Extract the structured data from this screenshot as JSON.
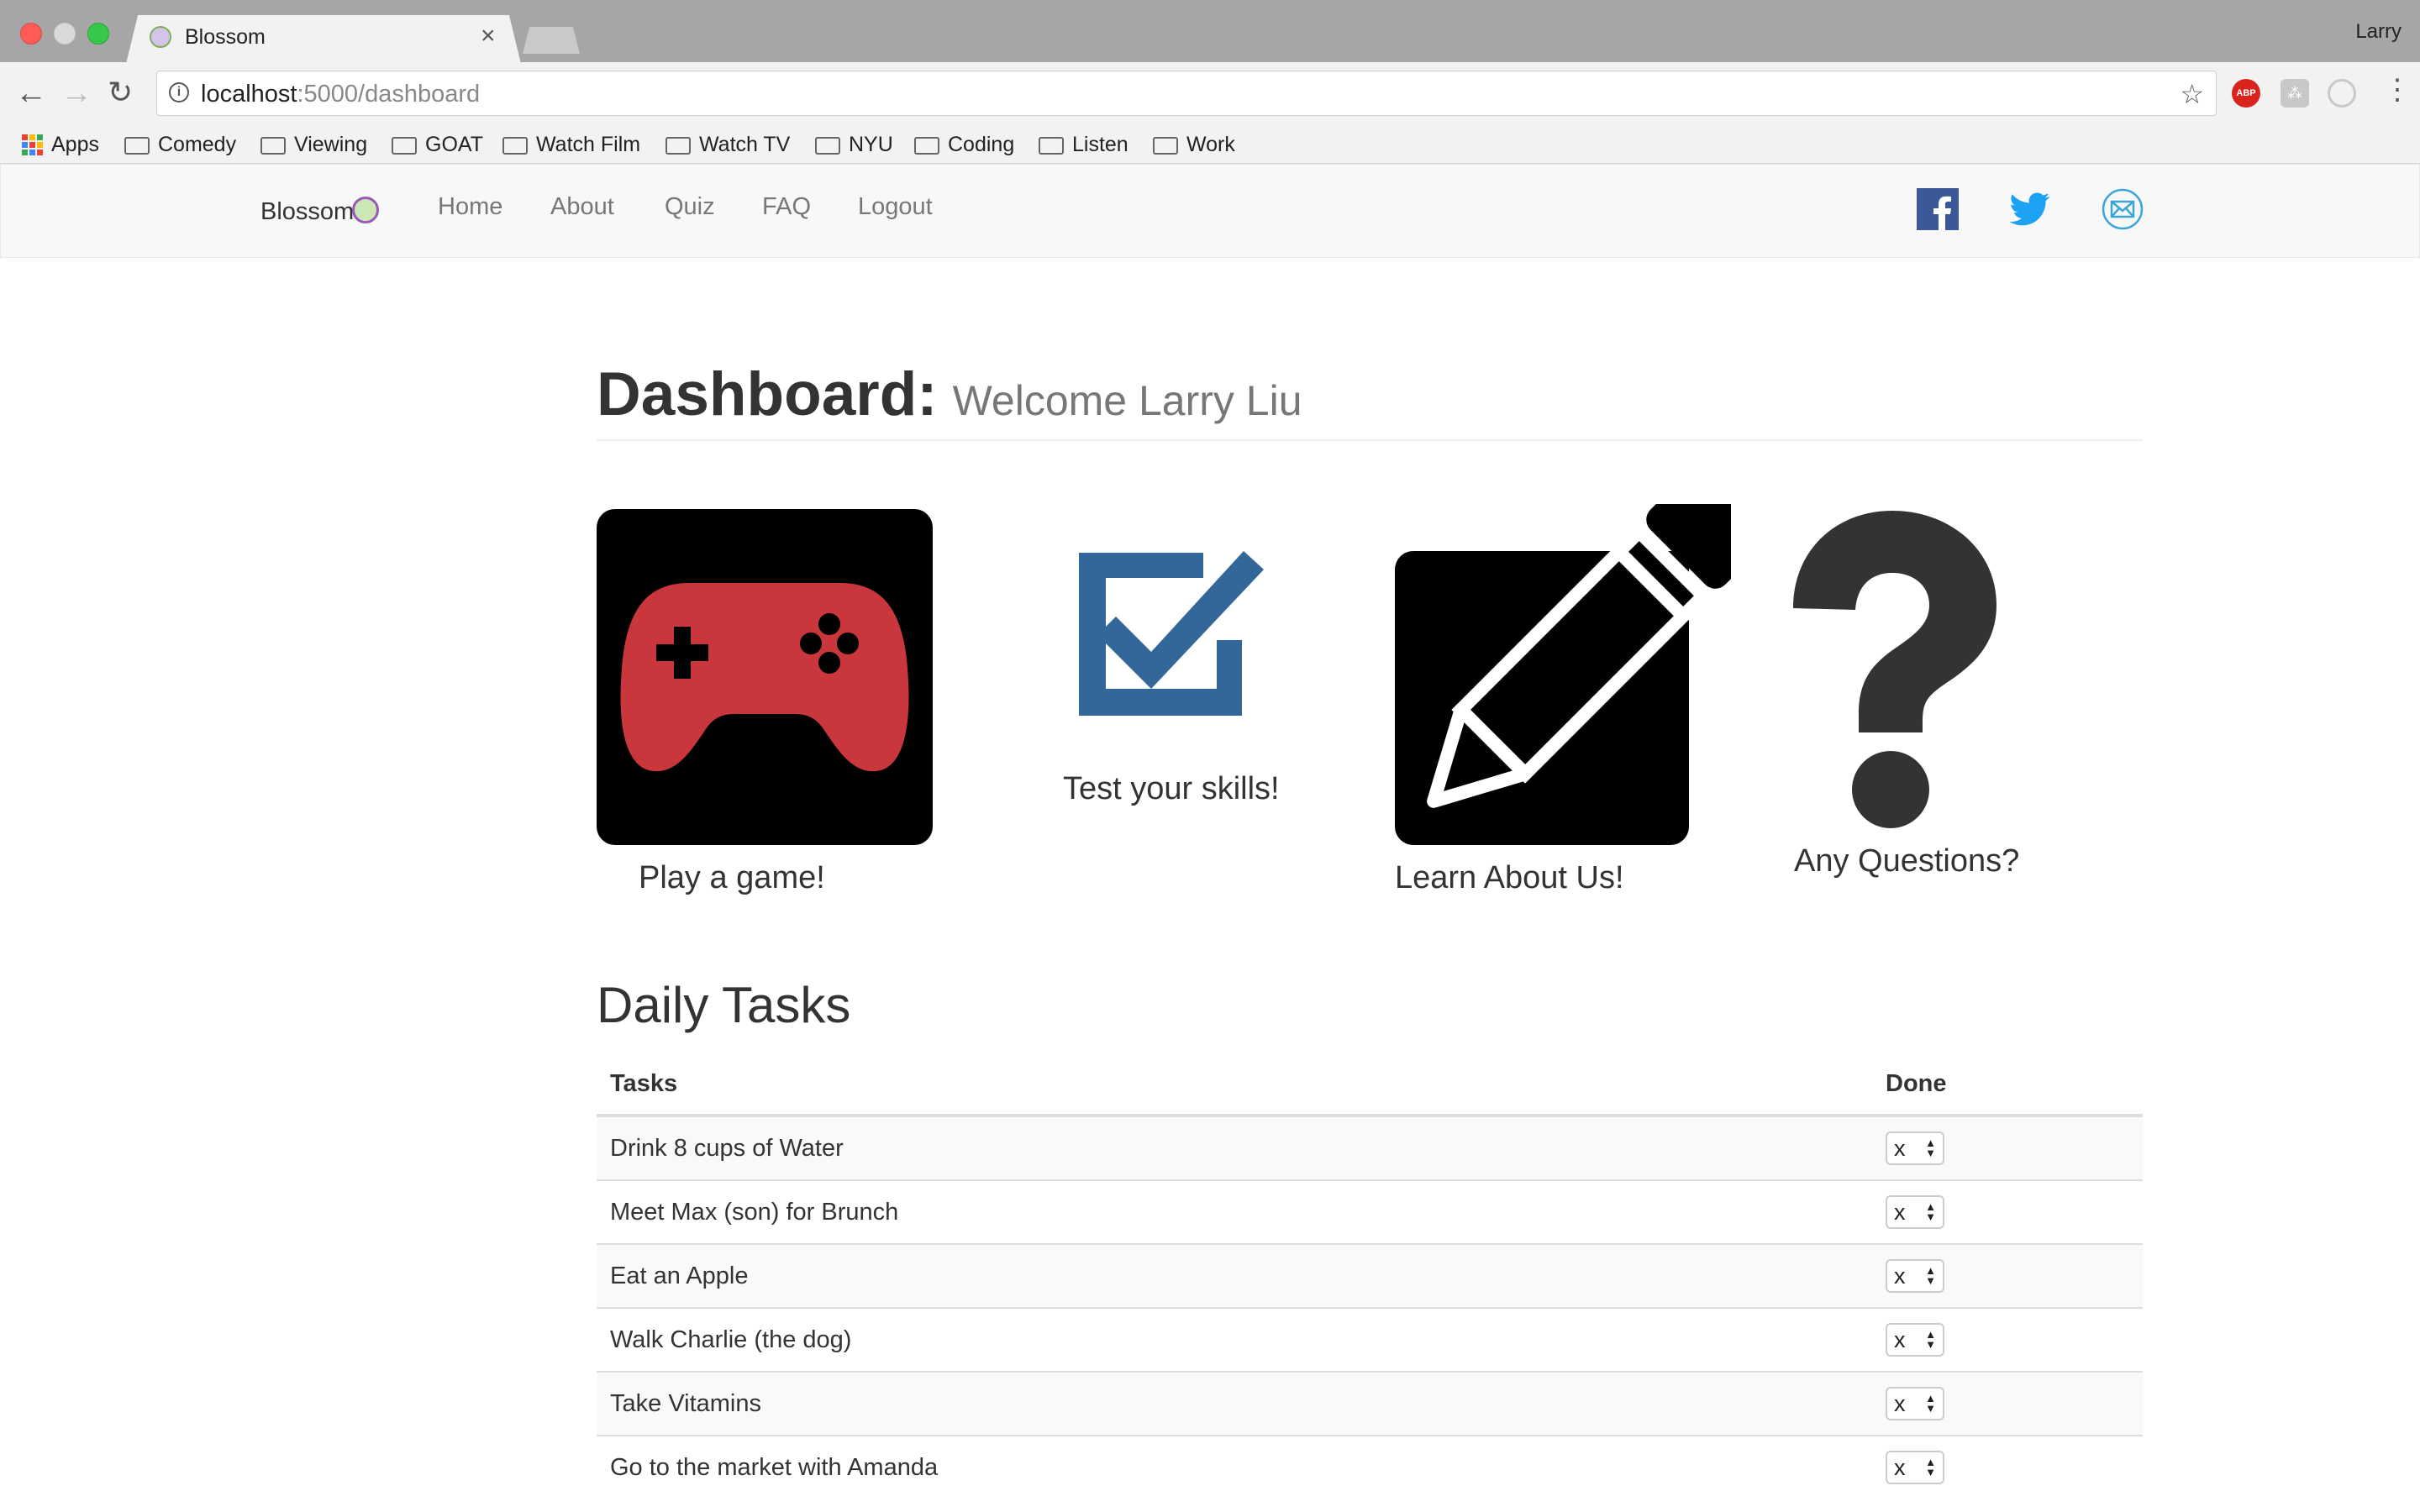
{
  "browser": {
    "tab_title": "Blossom",
    "tab_close": "×",
    "profile_name": "Larry",
    "url_host": "localhost",
    "url_path": ":5000/dashboard",
    "bookmarks": [
      "Apps",
      "Comedy",
      "Viewing",
      "GOAT",
      "Watch Film",
      "Watch TV",
      "NYU",
      "Coding",
      "Listen",
      "Work"
    ]
  },
  "navbar": {
    "brand": "Blossom",
    "links": [
      "Home",
      "About",
      "Quiz",
      "FAQ",
      "Logout"
    ],
    "social": [
      "facebook-icon",
      "twitter-icon",
      "mail-icon"
    ]
  },
  "dashboard": {
    "title": "Dashboard:",
    "welcome": "Welcome Larry Liu",
    "tiles": [
      {
        "label": "Play a game!",
        "icon": "gamepad-icon"
      },
      {
        "label": "Test your skills!",
        "icon": "checkbox-icon"
      },
      {
        "label": "Learn About Us!",
        "icon": "pencil-icon"
      },
      {
        "label": "Any Questions?",
        "icon": "question-mark-icon"
      }
    ]
  },
  "tasks": {
    "title": "Daily Tasks",
    "col_tasks": "Tasks",
    "col_done": "Done",
    "rows": [
      {
        "task": "Drink 8 cups of Water",
        "done": "x"
      },
      {
        "task": "Meet Max (son) for Brunch",
        "done": "x"
      },
      {
        "task": "Eat an Apple",
        "done": "x"
      },
      {
        "task": "Walk Charlie (the dog)",
        "done": "x"
      },
      {
        "task": "Take Vitamins",
        "done": "x"
      },
      {
        "task": "Go to the market with Amanda",
        "done": "x"
      }
    ]
  },
  "colors": {
    "gamepad": "#c9363b",
    "checkbox": "#336699",
    "facebook": "#3b5998",
    "twitter": "#1da1f2",
    "mail": "#3aa6d8"
  }
}
